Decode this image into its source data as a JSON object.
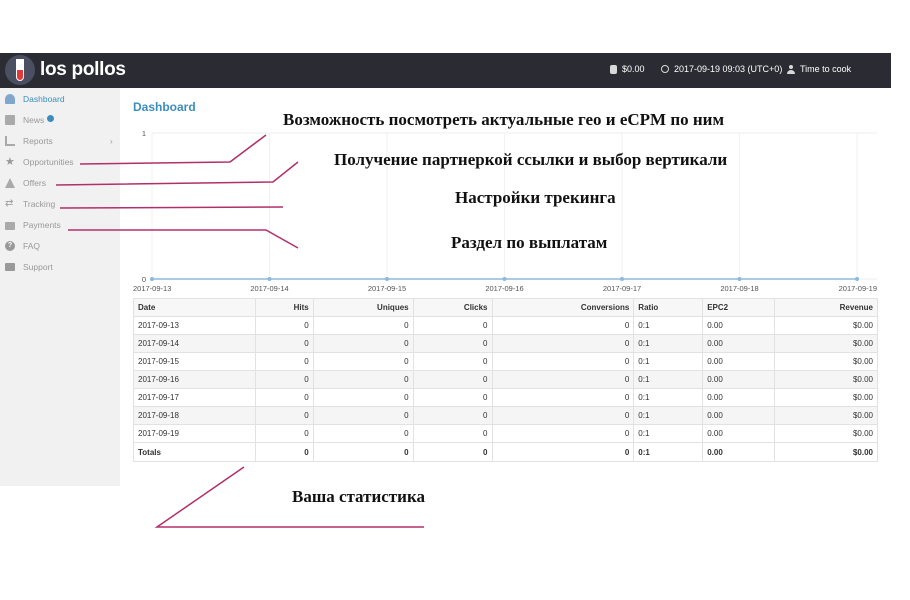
{
  "topbar": {
    "logo_text": "los pollos",
    "balance": "$0.00",
    "datetime": "2017-09-19 09:03 (UTC+0)",
    "user": "Time to cook",
    "icons": {
      "balance": "wallet-icon",
      "time": "clock-icon",
      "user": "user-icon"
    }
  },
  "sidebar": {
    "items": [
      {
        "label": "Dashboard",
        "icon": "dashboard-icon",
        "active": true
      },
      {
        "label": "News",
        "icon": "newspaper-icon",
        "badge": true
      },
      {
        "label": "Reports",
        "icon": "bar-chart-icon",
        "has_arrow": true,
        "arrow": "›"
      },
      {
        "label": "Opportunities",
        "icon": "star-icon"
      },
      {
        "label": "Offers",
        "icon": "flask-icon"
      },
      {
        "label": "Tracking",
        "icon": "exchange-icon"
      },
      {
        "label": "Payments",
        "icon": "briefcase-icon"
      },
      {
        "label": "FAQ",
        "icon": "question-circle-icon"
      },
      {
        "label": "Support",
        "icon": "envelope-icon"
      }
    ]
  },
  "main": {
    "title": "Dashboard"
  },
  "chart_data": {
    "type": "line",
    "x": [
      "2017-09-13",
      "2017-09-14",
      "2017-09-15",
      "2017-09-16",
      "2017-09-17",
      "2017-09-18",
      "2017-09-19"
    ],
    "series": [
      {
        "values": [
          0,
          0,
          0,
          0,
          0,
          0,
          0
        ]
      }
    ],
    "ylim": [
      0,
      1
    ],
    "yticks": [
      "0",
      "1"
    ],
    "grid": true,
    "color": "#8fb8dc"
  },
  "table": {
    "headers": [
      "Date",
      "Hits",
      "Uniques",
      "Clicks",
      "Conversions",
      "Ratio",
      "EPC2",
      "Revenue"
    ],
    "rows": [
      [
        "2017-09-13",
        "0",
        "0",
        "0",
        "0",
        "0:1",
        "0.00",
        "$0.00"
      ],
      [
        "2017-09-14",
        "0",
        "0",
        "0",
        "0",
        "0:1",
        "0.00",
        "$0.00"
      ],
      [
        "2017-09-15",
        "0",
        "0",
        "0",
        "0",
        "0:1",
        "0.00",
        "$0.00"
      ],
      [
        "2017-09-16",
        "0",
        "0",
        "0",
        "0",
        "0:1",
        "0.00",
        "$0.00"
      ],
      [
        "2017-09-17",
        "0",
        "0",
        "0",
        "0",
        "0:1",
        "0.00",
        "$0.00"
      ],
      [
        "2017-09-18",
        "0",
        "0",
        "0",
        "0",
        "0:1",
        "0.00",
        "$0.00"
      ],
      [
        "2017-09-19",
        "0",
        "0",
        "0",
        "0",
        "0:1",
        "0.00",
        "$0.00"
      ]
    ],
    "totals": [
      "Totals",
      "0",
      "0",
      "0",
      "0",
      "0:1",
      "0.00",
      "$0.00"
    ]
  },
  "annotations": {
    "opportunities": "Возможность посмотреть актуальные гео и eCPM по ним",
    "offers": "Получение партнеркой ссылки и выбор вертикали",
    "tracking": "Настройки трекинга",
    "payments": "Раздел по выплатам",
    "statistics": "Ваша статистика",
    "line_color": "#b0306a"
  }
}
